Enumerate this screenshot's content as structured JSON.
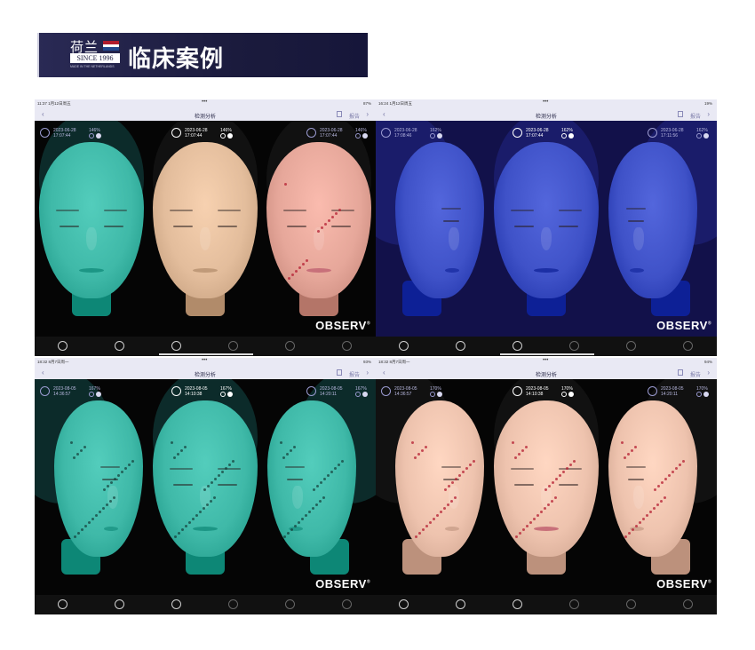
{
  "header": {
    "logo_cn": "荷兰",
    "logo_since": "SINCE 1996",
    "logo_tag": "MADE IN THE NETHERLANDS",
    "title": "临床案例",
    "flag_colors": [
      "#b01c2e",
      "#ffffff",
      "#21468b"
    ]
  },
  "panels": [
    {
      "status_time": "11:37  1月12日周五",
      "battery": "87%",
      "nav_title": "检测分析",
      "report_label": "报告",
      "brand": "OBSERV",
      "views": [
        {
          "date": "2023-06-28",
          "time": "17:07:44",
          "zoom": "146%",
          "tone": "teal"
        },
        {
          "date": "2023-06-28",
          "time": "17:07:44",
          "zoom": "146%",
          "tone": "natural"
        },
        {
          "date": "2023-06-28",
          "time": "17:07:44",
          "zoom": "146%",
          "tone": "pink"
        }
      ]
    },
    {
      "status_time": "16:24  1月12日周五",
      "battery": "19%",
      "nav_title": "检测分析",
      "report_label": "报告",
      "brand": "OBSERV",
      "views": [
        {
          "date": "2023-06-28",
          "time": "17:08:46",
          "zoom": "162%",
          "tone": "blue"
        },
        {
          "date": "2023-06-28",
          "time": "17:07:44",
          "zoom": "162%",
          "tone": "blue"
        },
        {
          "date": "2023-06-28",
          "time": "17:11:56",
          "zoom": "162%",
          "tone": "blue"
        }
      ]
    },
    {
      "status_time": "18:32  8月7日周一",
      "battery": "93%",
      "nav_title": "检测分析",
      "report_label": "报告",
      "brand": "OBSERV",
      "views": [
        {
          "date": "2023-08-05",
          "time": "14:36:57",
          "zoom": "167%",
          "tone": "teal"
        },
        {
          "date": "2023-08-05",
          "time": "14:10:38",
          "zoom": "167%",
          "tone": "teal"
        },
        {
          "date": "2023-08-05",
          "time": "14:20:11",
          "zoom": "167%",
          "tone": "teal"
        }
      ]
    },
    {
      "status_time": "18:32  8月7日周一",
      "battery": "94%",
      "nav_title": "检测分析",
      "report_label": "报告",
      "brand": "OBSERV",
      "views": [
        {
          "date": "2023-08-05",
          "time": "14:36:57",
          "zoom": "170%",
          "tone": "red"
        },
        {
          "date": "2023-08-05",
          "time": "14:10:38",
          "zoom": "170%",
          "tone": "red"
        },
        {
          "date": "2023-08-05",
          "time": "14:20:11",
          "zoom": "170%",
          "tone": "red"
        }
      ]
    }
  ],
  "tab_icons": [
    "face-scan-icon",
    "profile-icon",
    "analysis-icon",
    "compare-icon",
    "pigment-icon",
    "edit-icon"
  ],
  "colors": {
    "teal": "#3fb9a8",
    "natural": "#e3bd9c",
    "pink": "#e6a79a",
    "blue": "#3f52c8",
    "red": "#eec3ae"
  }
}
